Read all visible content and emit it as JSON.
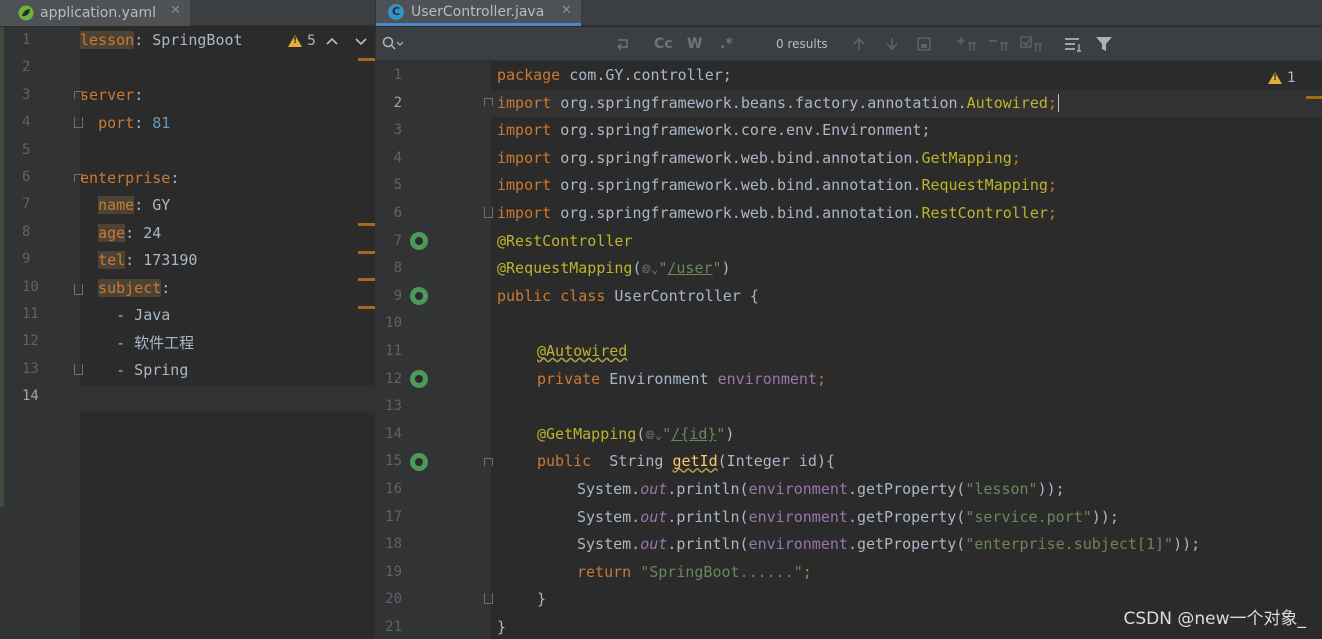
{
  "left_pane": {
    "tab_title": "application.yaml",
    "tab_close": "✕",
    "warning_count": "5",
    "current_line": "14",
    "lines": [
      {
        "n": "1",
        "key": "lesson",
        "rest": ": SpringBoot"
      },
      {
        "n": "2"
      },
      {
        "n": "3",
        "key": "server",
        "rest": ":"
      },
      {
        "n": "4",
        "indent": "  ",
        "key": "port",
        "rest": ": ",
        "num": "81"
      },
      {
        "n": "5"
      },
      {
        "n": "6",
        "key": "enterprise",
        "rest": ":"
      },
      {
        "n": "7",
        "indent": "  ",
        "key": "name",
        "rest": ": GY"
      },
      {
        "n": "8",
        "indent": "  ",
        "key": "age",
        "rest": ": 24"
      },
      {
        "n": "9",
        "indent": "  ",
        "key": "tel",
        "rest": ": 173190"
      },
      {
        "n": "10",
        "indent": "  ",
        "key": "subject",
        "rest": ":"
      },
      {
        "n": "11",
        "text": "    - Java"
      },
      {
        "n": "12",
        "text": "    - 软件工程"
      },
      {
        "n": "13",
        "text": "    - Spring"
      },
      {
        "n": "14"
      }
    ]
  },
  "right_pane": {
    "tab_title": "UserController.java",
    "tab_close": "✕",
    "tab_icon_letter": "C",
    "find_results": "0 results",
    "find_toggles": [
      "Cc",
      "W",
      ".*"
    ],
    "warning_count": "1",
    "current_line": "2",
    "line_numbers": [
      "1",
      "2",
      "3",
      "4",
      "5",
      "6",
      "7",
      "8",
      "9",
      "10",
      "11",
      "12",
      "13",
      "14",
      "15",
      "16",
      "17",
      "18",
      "19",
      "20",
      "21"
    ],
    "code": {
      "l1": {
        "kw": "package",
        "rest": " com.GY.controller;"
      },
      "l2": {
        "kw": "import",
        "pkg": " org.springframework.beans.factory.annotation.",
        "cls": "Autowired",
        "end": ";"
      },
      "l3": {
        "kw": "import",
        "rest": " org.springframework.core.env.Environment;"
      },
      "l4": {
        "kw": "import",
        "pkg": " org.springframework.web.bind.annotation.",
        "cls": "GetMapping",
        "end": ";"
      },
      "l5": {
        "kw": "import",
        "pkg": " org.springframework.web.bind.annotation.",
        "cls": "RequestMapping",
        "end": ";"
      },
      "l6": {
        "kw": "import",
        "pkg": " org.springframework.web.bind.annotation.",
        "cls": "RestController",
        "end": ";"
      },
      "l7": {
        "ann": "@RestController"
      },
      "l8": {
        "ann": "@RequestMapping",
        "open": "(",
        "str_q": "\"",
        "path": "/user",
        "close": "\")"
      },
      "l9": {
        "kw": "public class",
        "rest": " UserController {"
      },
      "l11": {
        "ann": "@Autowired"
      },
      "l12": {
        "kw": "private",
        "type": " Environment ",
        "fld": "environment",
        "end": ";"
      },
      "l14": {
        "ann": "@GetMapping",
        "open": "(",
        "str_q": "\"",
        "path": "/{id}",
        "close": "\")"
      },
      "l15": {
        "kw": "public",
        "type": "  String ",
        "method": "getId",
        "params": "(Integer ",
        "param": "id",
        "end": "){"
      },
      "l16": {
        "pre": "System.",
        "out": "out",
        "mid": ".println(",
        "fld": "environment",
        "call": ".getProperty(",
        "str": "\"lesson\"",
        "end": "));"
      },
      "l17": {
        "pre": "System.",
        "out": "out",
        "mid": ".println(",
        "fld": "environment",
        "call": ".getProperty(",
        "str": "\"service.port\"",
        "end": "));"
      },
      "l18": {
        "pre": "System.",
        "out": "out",
        "mid": ".println(",
        "fld": "environment",
        "call": ".getProperty(",
        "str": "\"enterprise.subject[1]\"",
        "end": "));"
      },
      "l19": {
        "kw": "return",
        "str": " \"SpringBoot......\"",
        "end": ";"
      },
      "l20": {
        "rest": "}"
      },
      "l21": {
        "rest": "}"
      }
    }
  },
  "watermark": "CSDN @new一个对象_",
  "colors": {
    "keyword": "#cc7832",
    "annotation": "#bbb529",
    "string": "#6a8759",
    "field": "#9876aa",
    "number": "#6897bb",
    "text": "#a9b7c6"
  }
}
